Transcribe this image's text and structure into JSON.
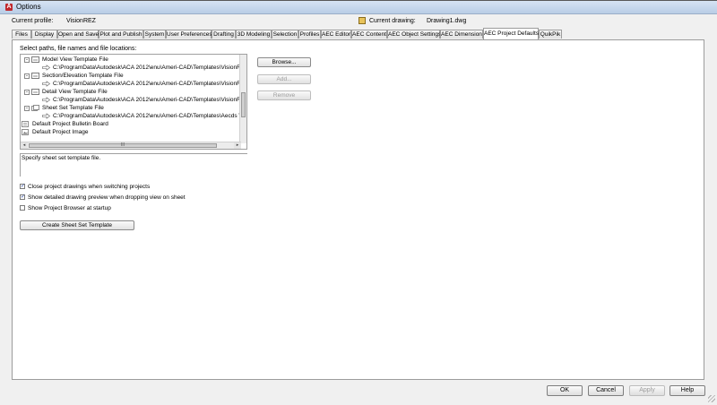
{
  "window": {
    "title": "Options"
  },
  "profile": {
    "current_profile_label": "Current profile:",
    "current_profile_value": "VisionREZ",
    "current_drawing_label": "Current drawing:",
    "current_drawing_value": "Drawing1.dwg"
  },
  "tabs": [
    {
      "label": "Files"
    },
    {
      "label": "Display"
    },
    {
      "label": "Open and Save"
    },
    {
      "label": "Plot and Publish"
    },
    {
      "label": "System"
    },
    {
      "label": "User Preferences"
    },
    {
      "label": "Drafting"
    },
    {
      "label": "3D Modeling"
    },
    {
      "label": "Selection"
    },
    {
      "label": "Profiles"
    },
    {
      "label": "AEC Editor"
    },
    {
      "label": "AEC Content"
    },
    {
      "label": "AEC Object Settings"
    },
    {
      "label": "AEC Dimension"
    },
    {
      "label": "AEC Project Defaults"
    },
    {
      "label": "QuikPik"
    }
  ],
  "active_tab": "AEC Project Defaults",
  "paths": {
    "label": "Select paths, file names and file locations:",
    "tree": [
      {
        "label": "Model View Template File",
        "expanded": "-"
      },
      {
        "label": "C:\\ProgramData\\Autodesk\\ACA 2012\\enu\\Ameri-CAD\\Templates\\VisionREZ_T"
      },
      {
        "label": "Section/Elevation Template File",
        "expanded": "-"
      },
      {
        "label": "C:\\ProgramData\\Autodesk\\ACA 2012\\enu\\Ameri-CAD\\Templates\\VisionREZ_T"
      },
      {
        "label": "Detail View Template File",
        "expanded": "-"
      },
      {
        "label": "C:\\ProgramData\\Autodesk\\ACA 2012\\enu\\Ameri-CAD\\Templates\\VisionREZ_T"
      },
      {
        "label": "Sheet Set Template File",
        "expanded": "-"
      },
      {
        "label": "C:\\ProgramData\\Autodesk\\ACA 2012\\enu\\Ameri-CAD\\Templates\\Aecds Vision"
      },
      {
        "label": "Default Project Bulletin Board"
      },
      {
        "label": "Default Project Image"
      }
    ],
    "scroll_glyph": "III"
  },
  "side_buttons": {
    "browse": "Browse...",
    "add": "Add...",
    "remove": "Remove"
  },
  "description": "Specify sheet set template file.",
  "options": [
    {
      "label": "Close project drawings when switching projects",
      "checked": "✓"
    },
    {
      "label": "Show detailed drawing preview when dropping view on sheet",
      "checked": "✓"
    },
    {
      "label": "Show Project Browser at startup",
      "checked": ""
    }
  ],
  "create_button": "Create Sheet Set Template",
  "dialog_buttons": {
    "ok": "OK",
    "cancel": "Cancel",
    "apply": "Apply",
    "help": "Help"
  },
  "colors": {
    "accent": "#1a3a9a",
    "dialog_bg": "#f0f0f0",
    "panel_bg": "#ffffff"
  }
}
